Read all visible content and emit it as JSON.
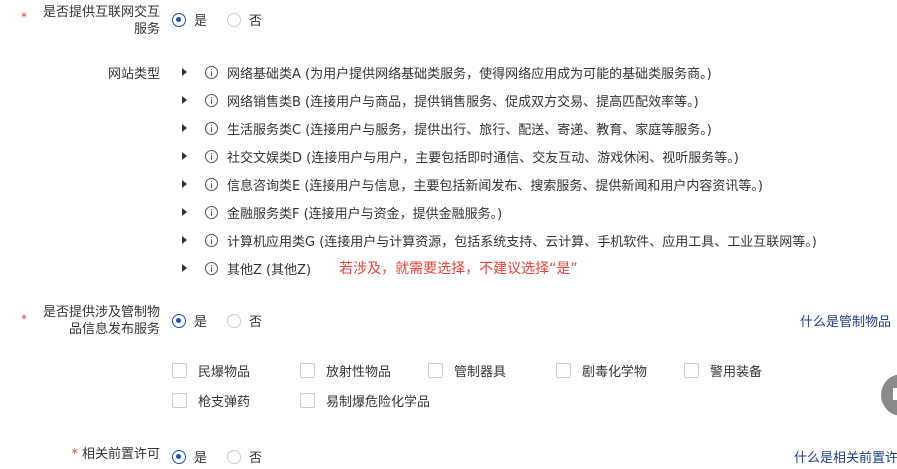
{
  "internet_service": {
    "required_mark": "*",
    "label_line1": "是否提供互联网交互",
    "label_line2": "服务",
    "options": [
      "是",
      "否"
    ],
    "selected": "是"
  },
  "site_type": {
    "label": "网站类型",
    "items": [
      {
        "label": "网络基础类A (为用户提供网络基础类服务，使得网络应用成为可能的基础类服务商。)"
      },
      {
        "label": "网络销售类B (连接用户与商品，提供销售服务、促成双方交易、提高匹配效率等。)"
      },
      {
        "label": "生活服务类C (连接用户与服务，提供出行、旅行、配送、寄递、教育、家庭等服务。)"
      },
      {
        "label": "社交文娱类D (连接用户与用户，主要包括即时通信、交友互动、游戏休闲、视听服务等。)"
      },
      {
        "label": "信息咨询类E (连接用户与信息，主要包括新闻发布、搜索服务、提供新闻和用户内容资讯等。)"
      },
      {
        "label": "金融服务类F (连接用户与资金，提供金融服务。)"
      },
      {
        "label": "计算机应用类G (连接用户与计算资源，包括系统支持、云计算、手机软件、应用工具、工业互联网等。)"
      },
      {
        "label": "其他Z (其他Z)"
      }
    ],
    "annotation": "若涉及，就需要选择，不建议选择“是”"
  },
  "controlled_items": {
    "required_mark": "*",
    "label_line1": "是否提供涉及管制物",
    "label_line2": "品信息发布服务",
    "options": [
      "是",
      "否"
    ],
    "selected": "是",
    "help_link": "什么是管制物品",
    "checkboxes": [
      "民爆物品",
      "放射性物品",
      "管制器具",
      "剧毒化学物",
      "警用装备",
      "枪支弹药",
      "易制爆危险化学品"
    ]
  },
  "pre_permit": {
    "required_mark": "*",
    "label": "相关前置许可",
    "options": [
      "是",
      "否"
    ],
    "selected": "是",
    "help_link": "什么是相关前置许"
  }
}
